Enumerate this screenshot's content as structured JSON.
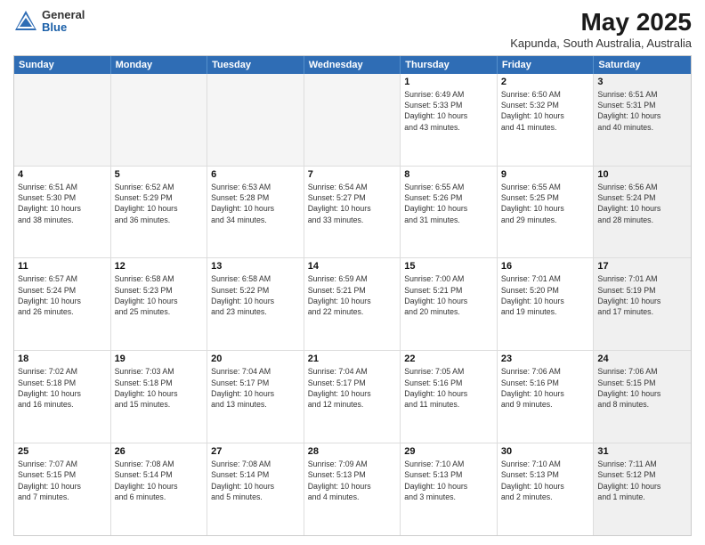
{
  "header": {
    "logo": {
      "general": "General",
      "blue": "Blue"
    },
    "title": "May 2025",
    "location": "Kapunda, South Australia, Australia"
  },
  "weekdays": [
    "Sunday",
    "Monday",
    "Tuesday",
    "Wednesday",
    "Thursday",
    "Friday",
    "Saturday"
  ],
  "weeks": [
    [
      {
        "day": "",
        "empty": true
      },
      {
        "day": "",
        "empty": true
      },
      {
        "day": "",
        "empty": true
      },
      {
        "day": "",
        "empty": true
      },
      {
        "day": "1",
        "info": "Sunrise: 6:49 AM\nSunset: 5:33 PM\nDaylight: 10 hours\nand 43 minutes."
      },
      {
        "day": "2",
        "info": "Sunrise: 6:50 AM\nSunset: 5:32 PM\nDaylight: 10 hours\nand 41 minutes."
      },
      {
        "day": "3",
        "info": "Sunrise: 6:51 AM\nSunset: 5:31 PM\nDaylight: 10 hours\nand 40 minutes.",
        "shaded": true
      }
    ],
    [
      {
        "day": "4",
        "info": "Sunrise: 6:51 AM\nSunset: 5:30 PM\nDaylight: 10 hours\nand 38 minutes."
      },
      {
        "day": "5",
        "info": "Sunrise: 6:52 AM\nSunset: 5:29 PM\nDaylight: 10 hours\nand 36 minutes."
      },
      {
        "day": "6",
        "info": "Sunrise: 6:53 AM\nSunset: 5:28 PM\nDaylight: 10 hours\nand 34 minutes."
      },
      {
        "day": "7",
        "info": "Sunrise: 6:54 AM\nSunset: 5:27 PM\nDaylight: 10 hours\nand 33 minutes."
      },
      {
        "day": "8",
        "info": "Sunrise: 6:55 AM\nSunset: 5:26 PM\nDaylight: 10 hours\nand 31 minutes."
      },
      {
        "day": "9",
        "info": "Sunrise: 6:55 AM\nSunset: 5:25 PM\nDaylight: 10 hours\nand 29 minutes."
      },
      {
        "day": "10",
        "info": "Sunrise: 6:56 AM\nSunset: 5:24 PM\nDaylight: 10 hours\nand 28 minutes.",
        "shaded": true
      }
    ],
    [
      {
        "day": "11",
        "info": "Sunrise: 6:57 AM\nSunset: 5:24 PM\nDaylight: 10 hours\nand 26 minutes."
      },
      {
        "day": "12",
        "info": "Sunrise: 6:58 AM\nSunset: 5:23 PM\nDaylight: 10 hours\nand 25 minutes."
      },
      {
        "day": "13",
        "info": "Sunrise: 6:58 AM\nSunset: 5:22 PM\nDaylight: 10 hours\nand 23 minutes."
      },
      {
        "day": "14",
        "info": "Sunrise: 6:59 AM\nSunset: 5:21 PM\nDaylight: 10 hours\nand 22 minutes."
      },
      {
        "day": "15",
        "info": "Sunrise: 7:00 AM\nSunset: 5:21 PM\nDaylight: 10 hours\nand 20 minutes."
      },
      {
        "day": "16",
        "info": "Sunrise: 7:01 AM\nSunset: 5:20 PM\nDaylight: 10 hours\nand 19 minutes."
      },
      {
        "day": "17",
        "info": "Sunrise: 7:01 AM\nSunset: 5:19 PM\nDaylight: 10 hours\nand 17 minutes.",
        "shaded": true
      }
    ],
    [
      {
        "day": "18",
        "info": "Sunrise: 7:02 AM\nSunset: 5:18 PM\nDaylight: 10 hours\nand 16 minutes."
      },
      {
        "day": "19",
        "info": "Sunrise: 7:03 AM\nSunset: 5:18 PM\nDaylight: 10 hours\nand 15 minutes."
      },
      {
        "day": "20",
        "info": "Sunrise: 7:04 AM\nSunset: 5:17 PM\nDaylight: 10 hours\nand 13 minutes."
      },
      {
        "day": "21",
        "info": "Sunrise: 7:04 AM\nSunset: 5:17 PM\nDaylight: 10 hours\nand 12 minutes."
      },
      {
        "day": "22",
        "info": "Sunrise: 7:05 AM\nSunset: 5:16 PM\nDaylight: 10 hours\nand 11 minutes."
      },
      {
        "day": "23",
        "info": "Sunrise: 7:06 AM\nSunset: 5:16 PM\nDaylight: 10 hours\nand 9 minutes."
      },
      {
        "day": "24",
        "info": "Sunrise: 7:06 AM\nSunset: 5:15 PM\nDaylight: 10 hours\nand 8 minutes.",
        "shaded": true
      }
    ],
    [
      {
        "day": "25",
        "info": "Sunrise: 7:07 AM\nSunset: 5:15 PM\nDaylight: 10 hours\nand 7 minutes."
      },
      {
        "day": "26",
        "info": "Sunrise: 7:08 AM\nSunset: 5:14 PM\nDaylight: 10 hours\nand 6 minutes."
      },
      {
        "day": "27",
        "info": "Sunrise: 7:08 AM\nSunset: 5:14 PM\nDaylight: 10 hours\nand 5 minutes."
      },
      {
        "day": "28",
        "info": "Sunrise: 7:09 AM\nSunset: 5:13 PM\nDaylight: 10 hours\nand 4 minutes."
      },
      {
        "day": "29",
        "info": "Sunrise: 7:10 AM\nSunset: 5:13 PM\nDaylight: 10 hours\nand 3 minutes."
      },
      {
        "day": "30",
        "info": "Sunrise: 7:10 AM\nSunset: 5:13 PM\nDaylight: 10 hours\nand 2 minutes."
      },
      {
        "day": "31",
        "info": "Sunrise: 7:11 AM\nSunset: 5:12 PM\nDaylight: 10 hours\nand 1 minute.",
        "shaded": true
      }
    ]
  ]
}
